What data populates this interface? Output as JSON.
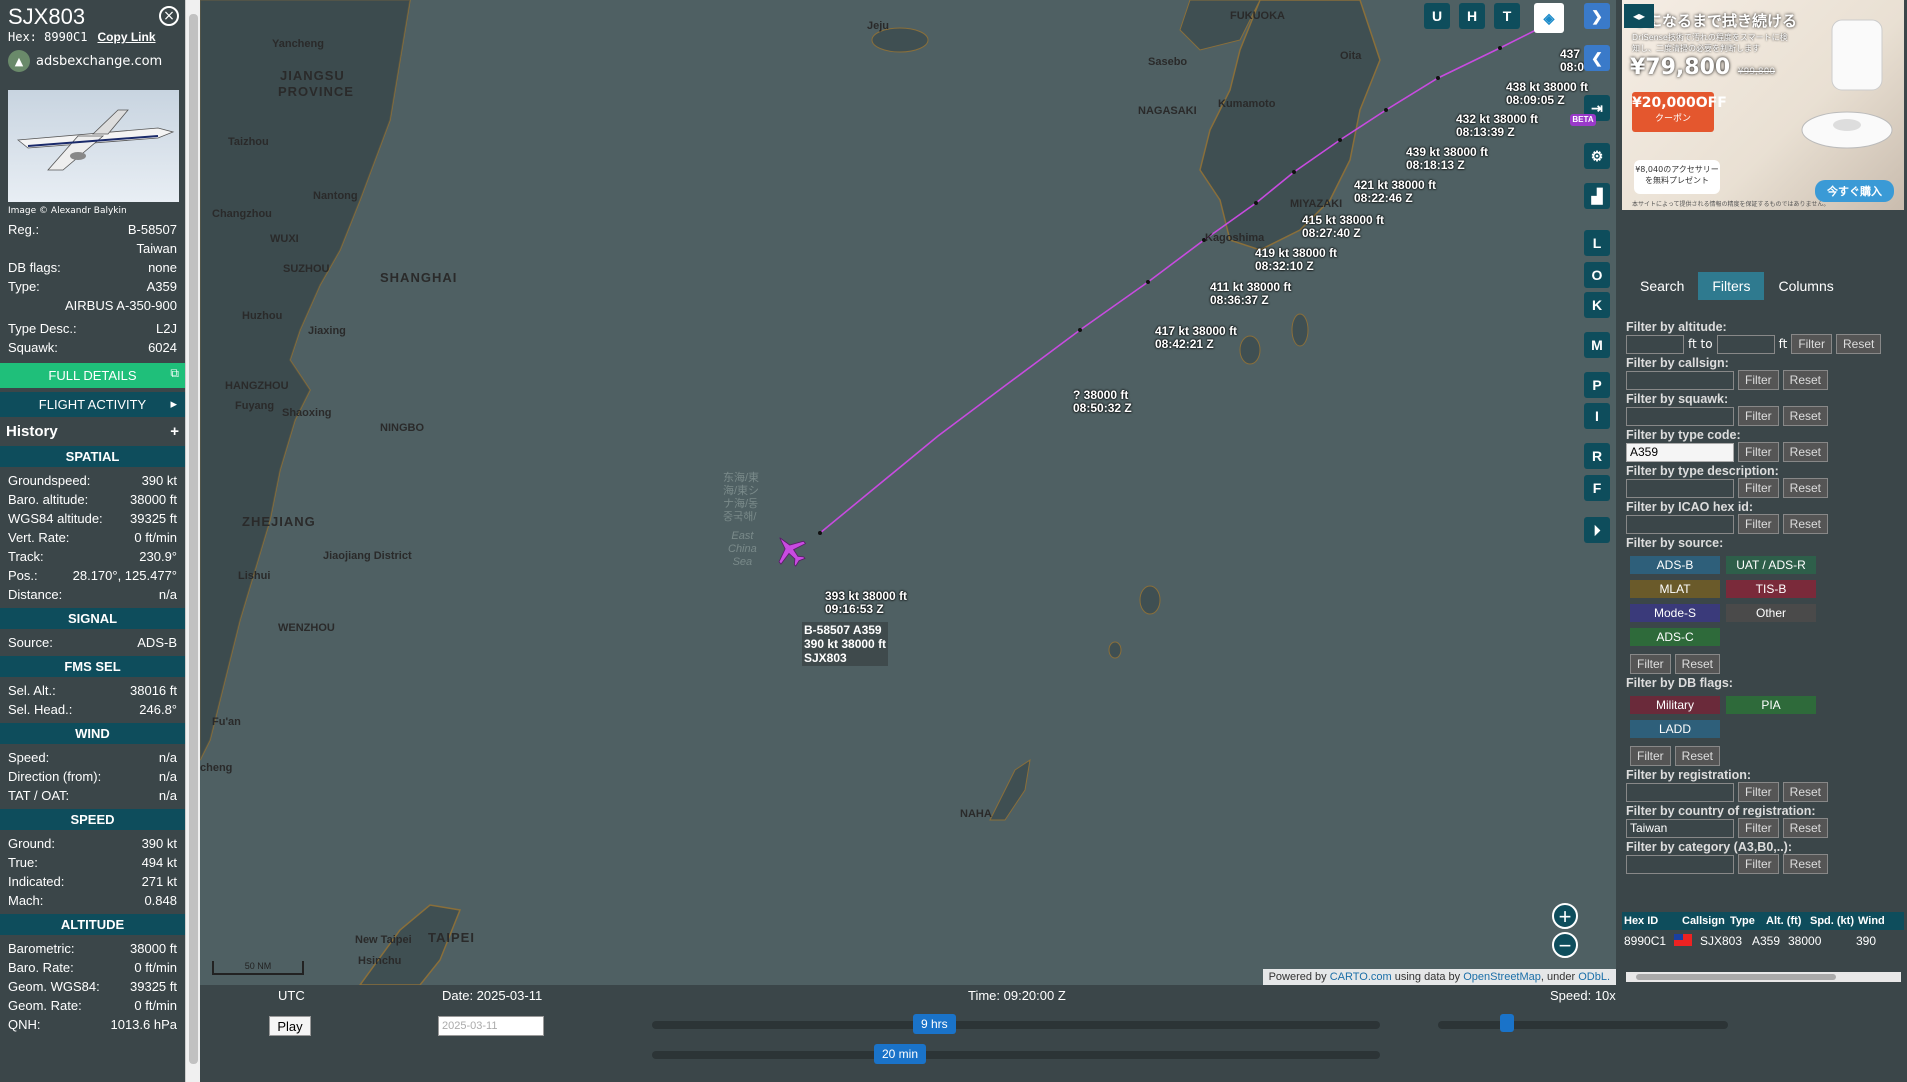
{
  "aircraft": {
    "callsign": "SJX803",
    "hex_label": "Hex:",
    "hex": "8990C1",
    "copy_link": "Copy Link",
    "site": "adsbexchange.com",
    "photo_credit": "Image © Alexandr Balykin",
    "reg_label": "Reg.:",
    "reg": "B-58507",
    "country": "Taiwan",
    "dbflags_label": "DB flags:",
    "dbflags": "none",
    "type_label": "Type:",
    "type": "A359",
    "type_full": "AIRBUS A-350-900",
    "typedesc_label": "Type Desc.:",
    "typedesc": "L2J",
    "squawk_label": "Squawk:",
    "squawk": "6024",
    "full_details": "FULL DETAILS",
    "flight_activity": "FLIGHT ACTIVITY",
    "history": "History"
  },
  "spatial": {
    "title": "SPATIAL",
    "rows": [
      {
        "k": "Groundspeed:",
        "v": "390 kt"
      },
      {
        "k": "Baro. altitude:",
        "v": "38000 ft"
      },
      {
        "k": "WGS84 altitude:",
        "v": "39325 ft"
      },
      {
        "k": "Vert. Rate:",
        "v": "0 ft/min"
      },
      {
        "k": "Track:",
        "v": "230.9°"
      },
      {
        "k": "Pos.:",
        "v": "28.170°, 125.477°"
      },
      {
        "k": "Distance:",
        "v": "n/a"
      }
    ]
  },
  "signal": {
    "title": "SIGNAL",
    "rows": [
      {
        "k": "Source:",
        "v": "ADS-B"
      }
    ]
  },
  "fms": {
    "title": "FMS SEL",
    "rows": [
      {
        "k": "Sel. Alt.:",
        "v": "38016 ft"
      },
      {
        "k": "Sel. Head.:",
        "v": "246.8°"
      }
    ]
  },
  "wind": {
    "title": "WIND",
    "rows": [
      {
        "k": "Speed:",
        "v": "n/a"
      },
      {
        "k": "Direction (from):",
        "v": "n/a"
      },
      {
        "k": "TAT / OAT:",
        "v": "n/a"
      }
    ]
  },
  "speed": {
    "title": "SPEED",
    "rows": [
      {
        "k": "Ground:",
        "v": "390 kt"
      },
      {
        "k": "True:",
        "v": "494 kt"
      },
      {
        "k": "Indicated:",
        "v": "271 kt"
      },
      {
        "k": "Mach:",
        "v": "0.848"
      }
    ]
  },
  "altitude": {
    "title": "ALTITUDE",
    "rows": [
      {
        "k": "Barometric:",
        "v": "38000 ft"
      },
      {
        "k": "Baro. Rate:",
        "v": "0 ft/min"
      },
      {
        "k": "Geom. WGS84:",
        "v": "39325 ft"
      },
      {
        "k": "Geom. Rate:",
        "v": "0 ft/min"
      },
      {
        "k": "QNH:",
        "v": "1013.6 hPa"
      }
    ]
  },
  "map": {
    "places": {
      "jeju": "Jeju",
      "fukuoka": "FUKUOKA",
      "sasebo": "Sasebo",
      "oita": "Oita",
      "nagasaki": "NAGASAKI",
      "kumamoto": "Kumamoto",
      "miyazaki": "MIYAZAKI",
      "kagoshima": "Kagoshima",
      "yancheng": "Yancheng",
      "jiangsu": "JIANGSU",
      "province": "PROVINCE",
      "taizhou": "Taizhou",
      "nantong": "Nantong",
      "changzhou": "Changzhou",
      "wuxi": "WUXI",
      "suzhou": "SUZHOU",
      "shanghai": "SHANGHAI",
      "huzhou": "Huzhou",
      "jiaxing": "Jiaxing",
      "hangzhou": "HANGZHOU",
      "fuyang": "Fuyang",
      "shaoxing": "Shaoxing",
      "ningbo": "NINGBO",
      "zhejiang": "ZHEJIANG",
      "jiaojiang": "Jiaojiang District",
      "lishui": "Lishui",
      "wenzhou": "WENZHOU",
      "fuan": "Fu'an",
      "cheng": "cheng",
      "naha": "NAHA",
      "taipei": "TAIPEI",
      "new_taipei": "New Taipei",
      "hsinchu": "Hsinchu",
      "sea_cjk": "东海/東\n海/東シ\nナ海/동\n중국해/",
      "sea_en": "East\nChina\nSea"
    },
    "track_labels": [
      {
        "l1": "437",
        "l2": "08:0"
      },
      {
        "l1": "438 kt  38000 ft",
        "l2": "08:09:05 Z"
      },
      {
        "l1": "432 kt  38000 ft",
        "l2": "08:13:39 Z"
      },
      {
        "l1": "439 kt  38000 ft",
        "l2": "08:18:13 Z"
      },
      {
        "l1": "421 kt  38000 ft",
        "l2": "08:22:46 Z"
      },
      {
        "l1": "415 kt  38000 ft",
        "l2": "08:27:40 Z"
      },
      {
        "l1": "419 kt  38000 ft",
        "l2": "08:32:10 Z"
      },
      {
        "l1": "411 kt  38000 ft",
        "l2": "08:36:37 Z"
      },
      {
        "l1": "417 kt  38000 ft",
        "l2": "08:42:21 Z"
      },
      {
        "l1": "?  38000 ft",
        "l2": "08:50:32 Z"
      },
      {
        "l1": "393 kt  38000 ft",
        "l2": "09:16:53 Z"
      }
    ],
    "plane_label": {
      "l1": "B-58507 A359",
      "l2": "390 kt  38000 ft",
      "l3": "SJX803"
    },
    "buttons": {
      "u": "U",
      "h": "H",
      "t": "T",
      "l": "L",
      "o": "O",
      "k": "K",
      "m": "M",
      "p": "P",
      "i": "I",
      "r": "R",
      "f": "F",
      "beta": "BETA"
    },
    "scale": "50 NM",
    "attribution_pre": "Powered by ",
    "attribution_carto": "CARTO.com",
    "attribution_mid": " using data by ",
    "attribution_osm": "OpenStreetMap",
    "attribution_post": ", under ",
    "attribution_odbl": "ODbL."
  },
  "ad": {
    "title": "イになるまで拭き続ける",
    "sub": "DriSense技術で汚れの程度をスマートに検知し、二度清掃の必要を判断します",
    "price": "¥79,800",
    "old_price": "¥99,800",
    "coupon": "¥20,000OFF",
    "coupon_sub": "クーポン",
    "gift": "¥8,040のアクセサリーを無料プレゼント",
    "buy": "今すぐ購入",
    "foot": "本サイトによって提供される情報の精度を保証するものではありません。"
  },
  "right": {
    "tabs": [
      "Search",
      "Filters",
      "Columns"
    ],
    "filters": {
      "altitude": "Filter by altitude:",
      "ft_to": "ft to",
      "ft": "ft",
      "callsign": "Filter by callsign:",
      "squawk": "Filter by squawk:",
      "typecode": "Filter by type code:",
      "typecode_value": "A359",
      "typedesc": "Filter by type description:",
      "icao": "Filter by ICAO hex id:",
      "source": "Filter by source:",
      "dbflags": "Filter by DB flags:",
      "registration": "Filter by registration:",
      "country": "Filter by country of registration:",
      "country_value": "Taiwan",
      "category": "Filter by category (A3,B0,..):",
      "filter_btn": "Filter",
      "reset_btn": "Reset"
    },
    "sources": [
      {
        "label": "ADS-B",
        "color": "#2e5f7a"
      },
      {
        "label": "UAT / ADS-R",
        "color": "#2e5f4a"
      },
      {
        "label": "MLAT",
        "color": "#6a5a2a"
      },
      {
        "label": "TIS-B",
        "color": "#7a2a3a"
      },
      {
        "label": "Mode-S",
        "color": "#3a3a7a"
      },
      {
        "label": "Other",
        "color": "#4a4a4a"
      },
      {
        "label": "ADS-C",
        "color": "#2e6a3a"
      }
    ],
    "dbflag_btns": [
      {
        "label": "Military",
        "color": "#6a2a3a"
      },
      {
        "label": "PIA",
        "color": "#2e6a3a"
      },
      {
        "label": "LADD",
        "color": "#2e5f7a"
      }
    ],
    "table": {
      "headers": [
        "Hex ID",
        "Callsign",
        "Type",
        "Alt. (ft)",
        "Spd. (kt)",
        "Wind"
      ],
      "row": {
        "hex": "8990C1",
        "callsign": "SJX803",
        "type": "A359",
        "alt": "38000",
        "spd": "390"
      }
    }
  },
  "timeline": {
    "utc": "UTC",
    "date": "Date: 2025-03-11",
    "time": "Time: 09:20:00 Z",
    "speed": "Speed: 10x",
    "play": "Play",
    "date_input": "2025-03-11",
    "hrs": "9 hrs",
    "min": "20 min"
  }
}
